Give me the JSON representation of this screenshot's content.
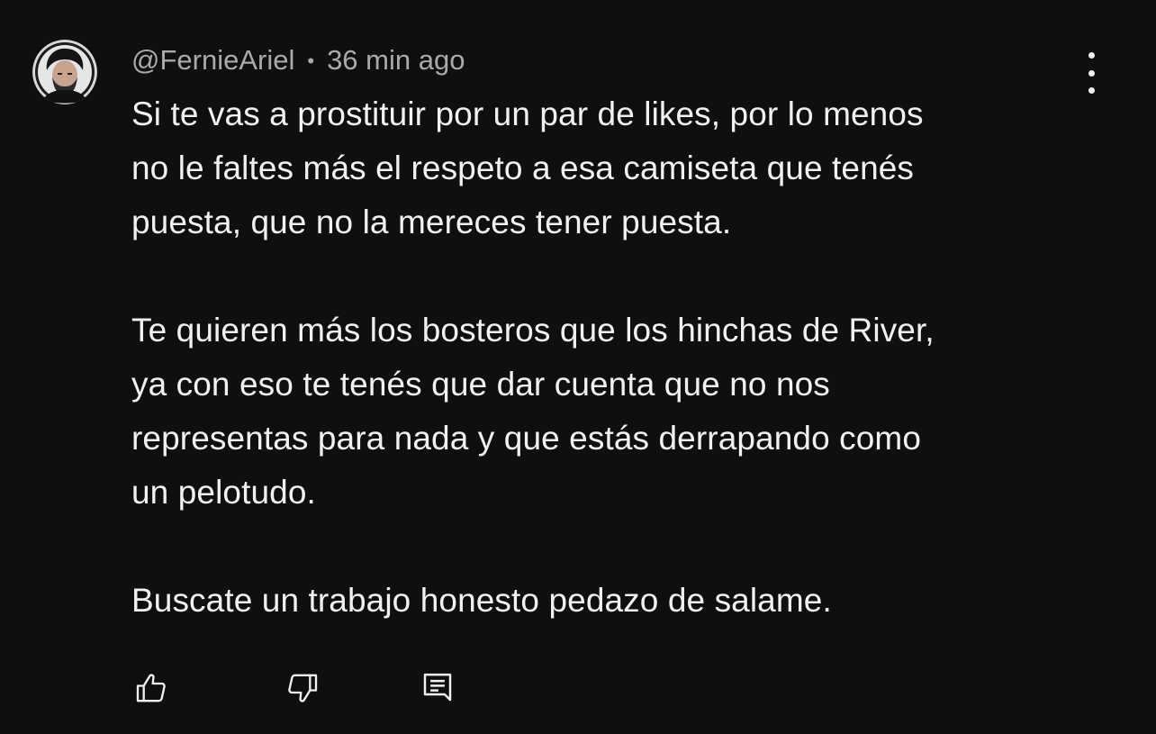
{
  "comment": {
    "author": "@FernieAriel",
    "separator": "•",
    "timestamp": "36 min ago",
    "paragraphs": [
      "Si te vas a prostituir por un par de likes, por lo menos\nno le faltes más el respeto a esa camiseta que tenés\npuesta, que no la mereces tener puesta.",
      "Te quieren más los bosteros que los hinchas de River,\nya con eso te tenés que dar cuenta que no nos\nrepresentas para nada y que estás derrapando como\nun pelotudo.",
      "Buscate un trabajo honesto pedazo de salame."
    ],
    "actions": {
      "like_icon": "thumbs-up-icon",
      "dislike_icon": "thumbs-down-icon",
      "reply_icon": "reply-comment-icon"
    },
    "menu_icon": "more-vertical-icon"
  },
  "colors": {
    "background": "#0f0f0f",
    "primary_text": "#f1f1f1",
    "secondary_text": "#aaaaaa"
  }
}
